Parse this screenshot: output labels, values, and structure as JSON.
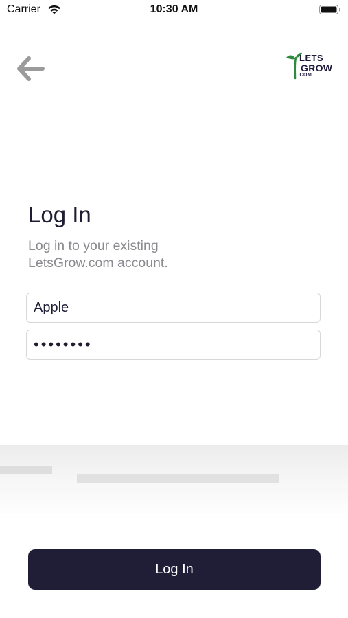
{
  "status_bar": {
    "carrier": "Carrier",
    "time": "10:30 AM",
    "wifi_icon": "wifi-icon",
    "battery_icon": "battery-icon"
  },
  "nav": {
    "back_icon": "arrow-left-icon"
  },
  "logo": {
    "line1": "LETS",
    "line2": "GROW",
    "line3": ".COM",
    "sprout_color": "#2e8b3e"
  },
  "login": {
    "title": "Log In",
    "subtitle": "Log in to your existing LetsGrow.com account.",
    "username_value": "Apple",
    "password_value": "••••••••",
    "button_label": "Log In"
  },
  "colors": {
    "primary": "#201d37",
    "muted_text": "#8a8a8f",
    "border": "#d8d8dc",
    "back_arrow": "#9b9b9b"
  }
}
